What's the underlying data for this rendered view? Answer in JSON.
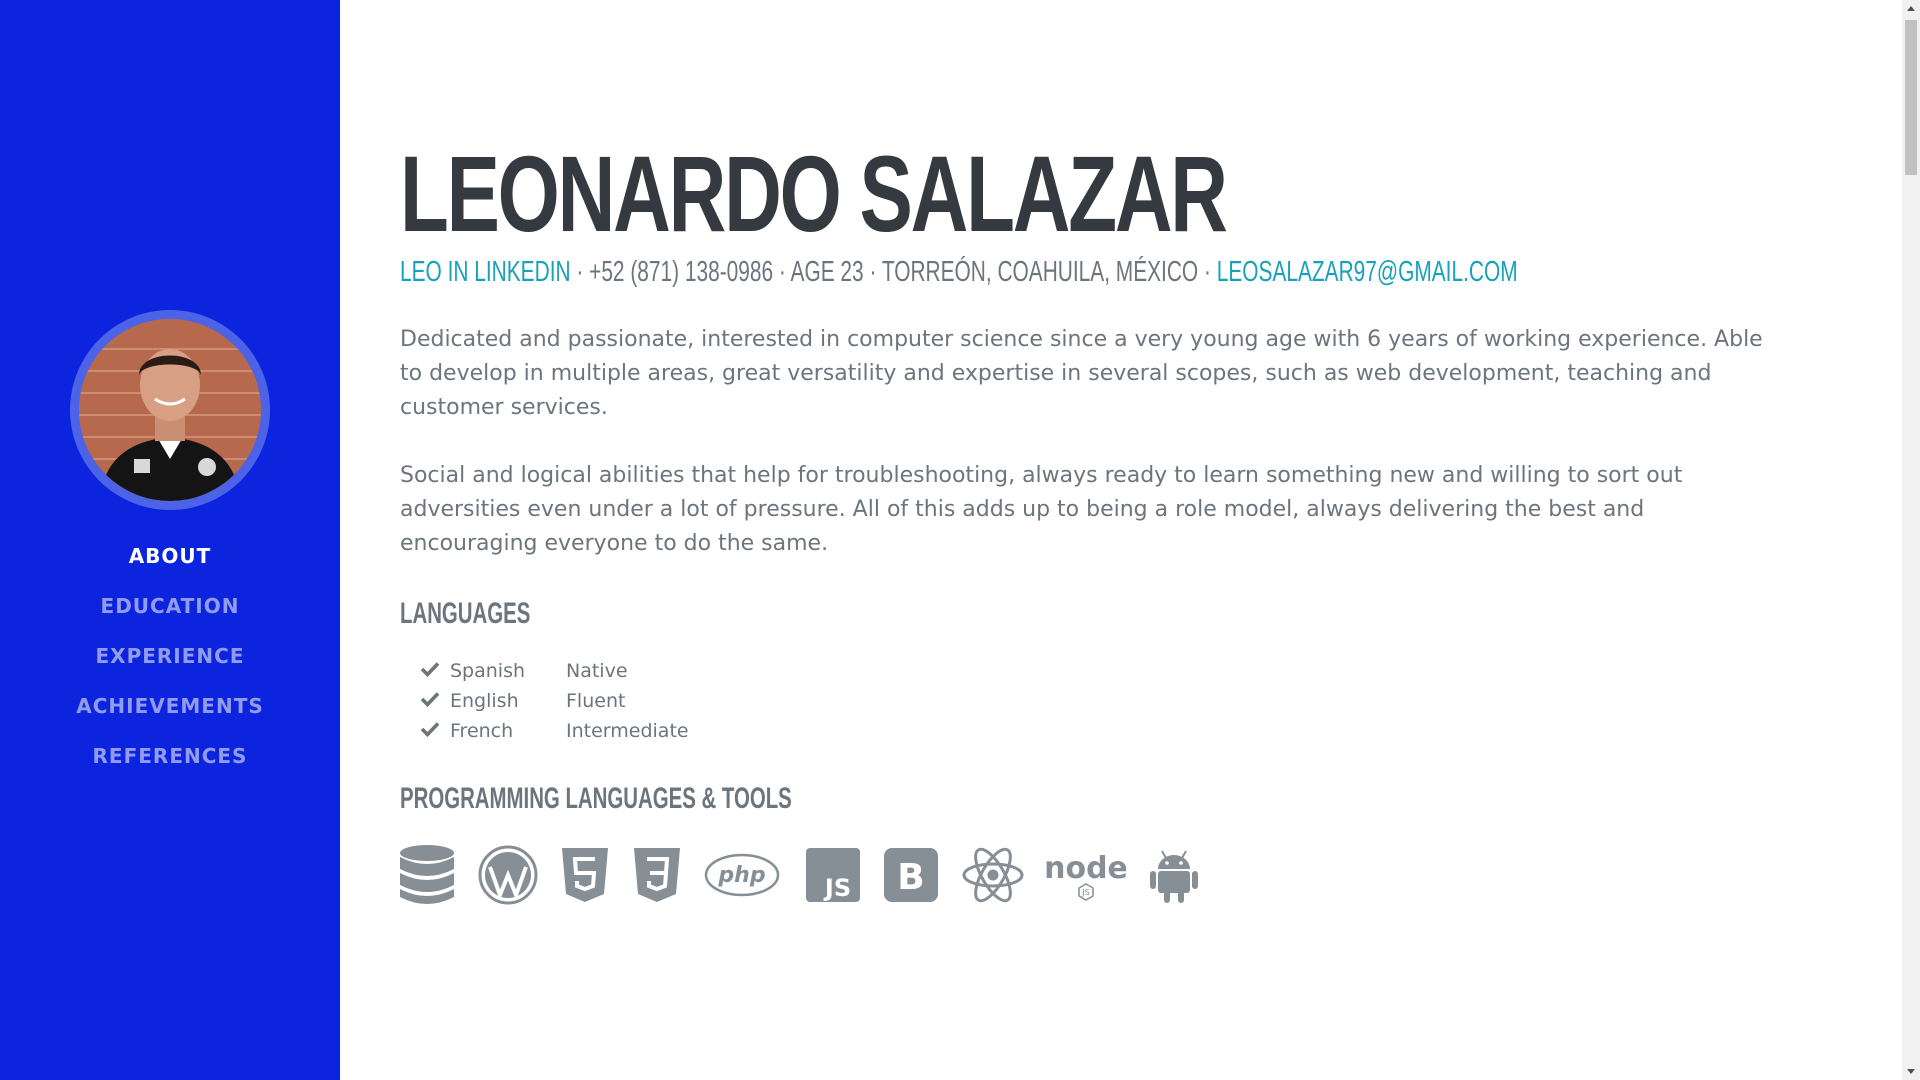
{
  "sidebar": {
    "avatar_alt": "profile photo",
    "nav": [
      {
        "label": "ABOUT",
        "active": true
      },
      {
        "label": "EDUCATION",
        "active": false
      },
      {
        "label": "EXPERIENCE",
        "active": false
      },
      {
        "label": "ACHIEVEMENTS",
        "active": false
      },
      {
        "label": "REFERENCES",
        "active": false
      }
    ]
  },
  "about": {
    "name": "LEONARDO SALAZAR",
    "linkedin_label": "LEO IN LINKEDIN",
    "contact_info": " · +52 (871) 138-0986 · AGE 23 · TORREÓN, COAHUILA, MÉXICO · ",
    "email": "LEOSALAZAR97@GMAIL.COM",
    "paragraph_1": "Dedicated and passionate, interested in computer science since a very young age with 6 years of working experience. Able to develop in multiple areas, great versatility and expertise in several scopes, such as web development, teaching and customer services.",
    "paragraph_2": "Social and logical abilities that help for troubleshooting, always ready to learn something new and willing to sort out adversities even under a lot of pressure. All of this adds up to being a role model, always delivering the best and encouraging everyone to do the same."
  },
  "languages": {
    "heading": "LANGUAGES",
    "items": [
      {
        "name": "Spanish",
        "level": "Native"
      },
      {
        "name": "English",
        "level": "Fluent"
      },
      {
        "name": "French",
        "level": "Intermediate"
      }
    ]
  },
  "tools": {
    "heading": "PROGRAMMING LANGUAGES & TOOLS",
    "icons": [
      "database-icon",
      "wordpress-icon",
      "html5-icon",
      "css3-icon",
      "php-icon",
      "js-icon",
      "bootstrap-icon",
      "react-icon",
      "nodejs-icon",
      "android-icon"
    ],
    "php_text": "php",
    "js_text": "JS",
    "bootstrap_text": "B",
    "node_text": "node",
    "node_badge": "JS"
  },
  "colors": {
    "sidebar_bg": "#0d24de",
    "accent": "#17a2b8",
    "heading": "#343a40",
    "muted": "#6c757d",
    "icon": "#868e96"
  }
}
